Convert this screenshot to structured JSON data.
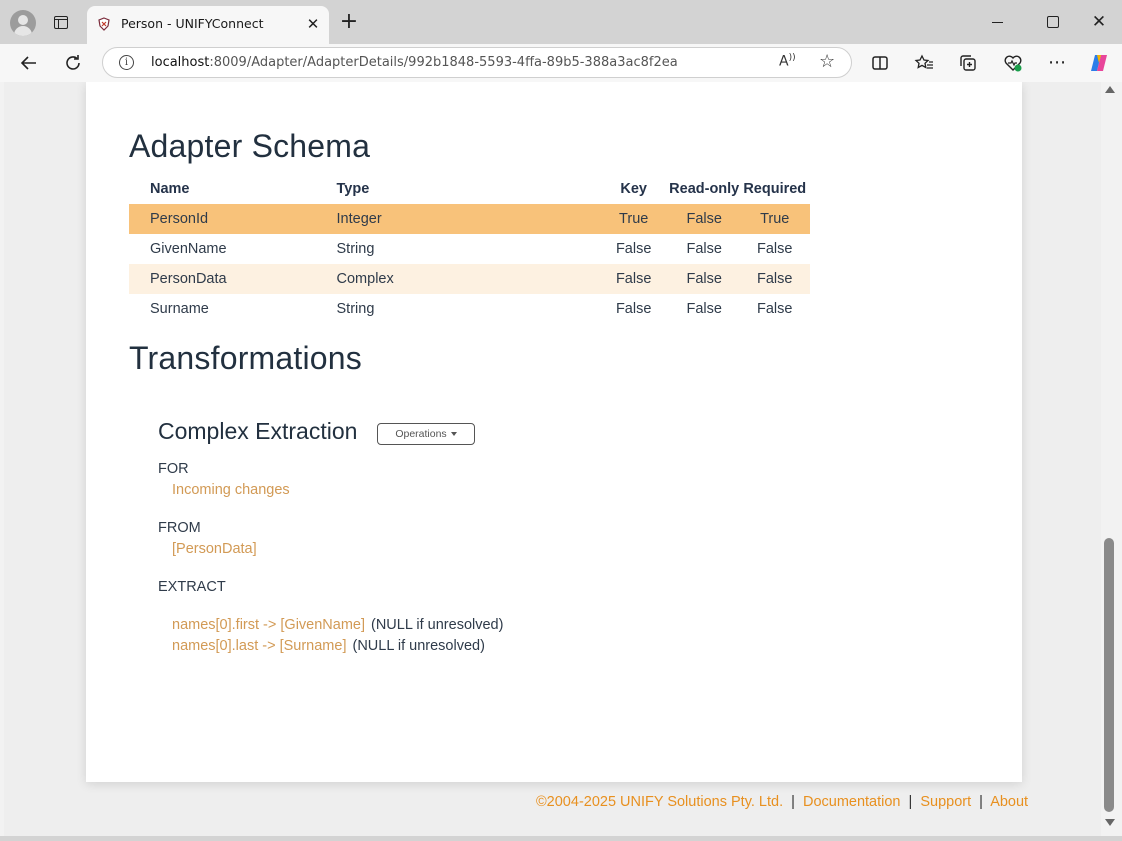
{
  "browser": {
    "tab_title": "Person - UNIFYConnect",
    "url_host": "localhost",
    "url_path": ":8009/Adapter/AdapterDetails/992b1848-5593-4ffa-89b5-388a3ac8f2ea",
    "tab_close": "✕",
    "new_tab": "+",
    "window_close": "✕"
  },
  "schema": {
    "title": "Adapter Schema",
    "headers": {
      "name": "Name",
      "type": "Type",
      "key": "Key",
      "readonly": "Read-only",
      "required": "Required"
    },
    "rows": [
      {
        "name": "PersonId",
        "type": "Integer",
        "key": "True",
        "readonly": "False",
        "required": "True"
      },
      {
        "name": "GivenName",
        "type": "String",
        "key": "False",
        "readonly": "False",
        "required": "False"
      },
      {
        "name": "PersonData",
        "type": "Complex",
        "key": "False",
        "readonly": "False",
        "required": "False"
      },
      {
        "name": "Surname",
        "type": "String",
        "key": "False",
        "readonly": "False",
        "required": "False"
      }
    ]
  },
  "transformations": {
    "title": "Transformations",
    "items": [
      {
        "title": "Complex Extraction",
        "operations_label": "Operations",
        "for_label": "FOR",
        "for_value": "Incoming changes",
        "from_label": "FROM",
        "from_value": "[PersonData]",
        "extract_label": "EXTRACT",
        "extracts": [
          {
            "mapping": "names[0].first -> [GivenName]",
            "note": "(NULL if unresolved)"
          },
          {
            "mapping": "names[0].last -> [Surname]",
            "note": "(NULL if unresolved)"
          }
        ]
      }
    ]
  },
  "footer": {
    "copyright": "©2004-2025 UNIFY Solutions Pty. Ltd.",
    "separator": "|",
    "links": [
      "Documentation",
      "Support",
      "About"
    ]
  },
  "colors": {
    "accent": "#e8901f",
    "key_row": "#f8c27a",
    "alt_row": "#fdf1e1",
    "link_value": "#d29a55"
  }
}
